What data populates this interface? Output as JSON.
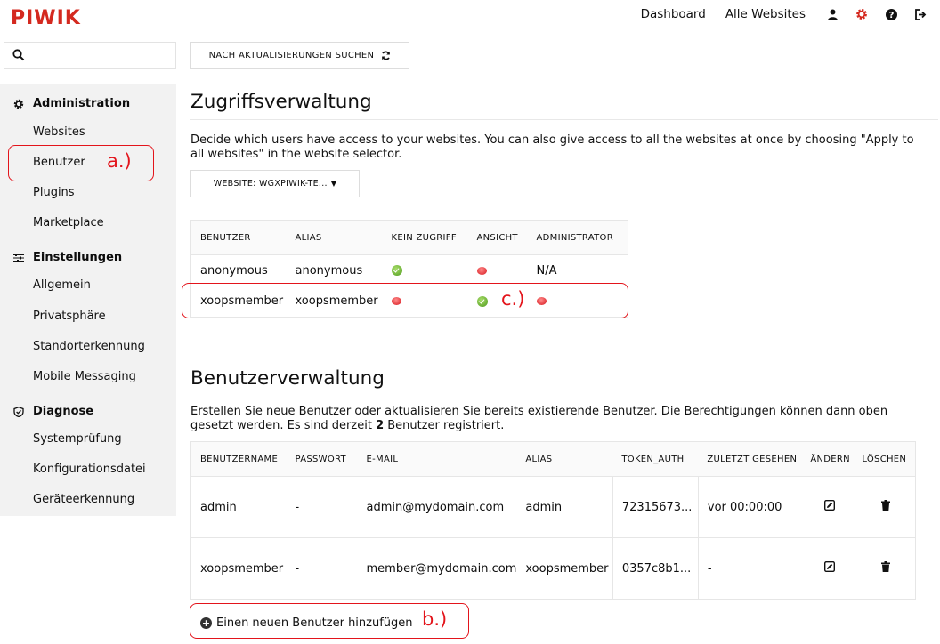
{
  "app": {
    "logo": "PIWIK"
  },
  "topnav": {
    "dashboard": "Dashboard",
    "all_websites": "Alle Websites",
    "icons": [
      "user-icon",
      "gear-icon",
      "help-icon",
      "logout-icon"
    ],
    "accent_color": "#d4291f"
  },
  "search": {
    "placeholder": "",
    "value": ""
  },
  "sidebar": {
    "sections": [
      {
        "title": "Administration",
        "icon": "gear-icon",
        "items": [
          "Websites",
          "Benutzer",
          "Plugins",
          "Marketplace"
        ]
      },
      {
        "title": "Einstellungen",
        "icon": "sliders-icon",
        "items": [
          "Allgemein",
          "Privatsphäre",
          "Standorterkennung",
          "Mobile Messaging"
        ]
      },
      {
        "title": "Diagnose",
        "icon": "shield-icon",
        "items": [
          "Systemprüfung",
          "Konfigurationsdatei",
          "Geräteerkennung"
        ]
      }
    ]
  },
  "annotations": {
    "a": "a.)",
    "b": "b.)",
    "c": "c.)",
    "color": "#e3141b"
  },
  "update_button": "NACH AKTUALISIERUNGEN SUCHEN",
  "access": {
    "title": "Zugriffsverwaltung",
    "description": "Decide which users have access to your websites. You can also give access to all the websites at once by choosing \"Apply to all websites\" in the website selector.",
    "website_selector": "WEBSITE: WGXPIWIK-TE...",
    "columns": [
      "BENUTZER",
      "ALIAS",
      "KEIN ZUGRIFF",
      "ANSICHT",
      "ADMINISTRATOR"
    ],
    "rows": [
      {
        "user": "anonymous",
        "alias": "anonymous",
        "no_access": "green",
        "view": "red",
        "admin": "N/A"
      },
      {
        "user": "xoopsmember",
        "alias": "xoopsmember",
        "no_access": "red",
        "view": "green",
        "admin": "red"
      }
    ]
  },
  "users": {
    "title": "Benutzerverwaltung",
    "description_before": "Erstellen Sie neue Benutzer oder aktualisieren Sie bereits existierende Benutzer. Die Berechtigungen können dann oben gesetzt werden. Es sind derzeit ",
    "count": "2",
    "description_after": " Benutzer registriert.",
    "columns": [
      "BENUTZERNAME",
      "PASSWORT",
      "E-MAIL",
      "ALIAS",
      "TOKEN_AUTH",
      "ZULETZT GESEHEN",
      "ÄNDERN",
      "LÖSCHEN"
    ],
    "rows": [
      {
        "username": "admin",
        "password": "-",
        "email": "admin@mydomain.com",
        "alias": "admin",
        "token": "72315673...",
        "last_seen": "vor 00:00:00"
      },
      {
        "username": "xoopsmember",
        "password": "-",
        "email": "member@mydomain.com",
        "alias": "xoopsmember",
        "token": "0357c8b1...",
        "last_seen": "-"
      }
    ],
    "add_user": "Einen neuen Benutzer hinzufügen"
  }
}
